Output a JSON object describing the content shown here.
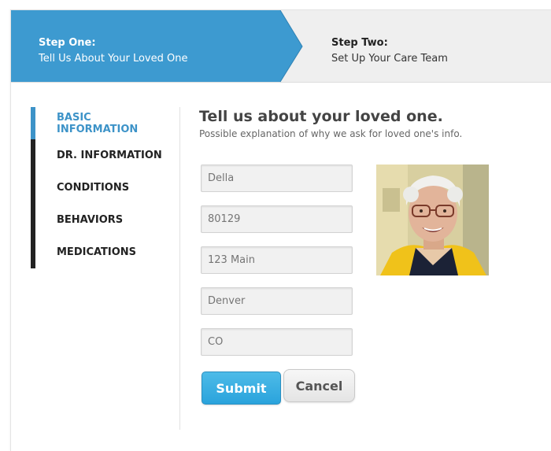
{
  "steps": {
    "step_one_title": "Step One:",
    "step_one_subtitle": "Tell Us About Your Loved One",
    "step_two_title": "Step Two:",
    "step_two_subtitle": "Set Up Your Care Team",
    "active_color": "#3d9ad0"
  },
  "sidebar": {
    "items": [
      {
        "label": "BASIC INFORMATION",
        "active": true
      },
      {
        "label": "DR. INFORMATION",
        "active": false
      },
      {
        "label": "CONDITIONS",
        "active": false
      },
      {
        "label": "BEHAVIORS",
        "active": false
      },
      {
        "label": "MEDICATIONS",
        "active": false
      }
    ]
  },
  "main": {
    "title": "Tell us about your loved one.",
    "subtitle": "Possible explanation of why we ask for loved one's info.",
    "fields": [
      {
        "placeholder": "Della"
      },
      {
        "placeholder": "80129"
      },
      {
        "placeholder": "123 Main"
      },
      {
        "placeholder": "Denver"
      },
      {
        "placeholder": "CO"
      }
    ],
    "submit_label": "Submit",
    "cancel_label": "Cancel"
  }
}
